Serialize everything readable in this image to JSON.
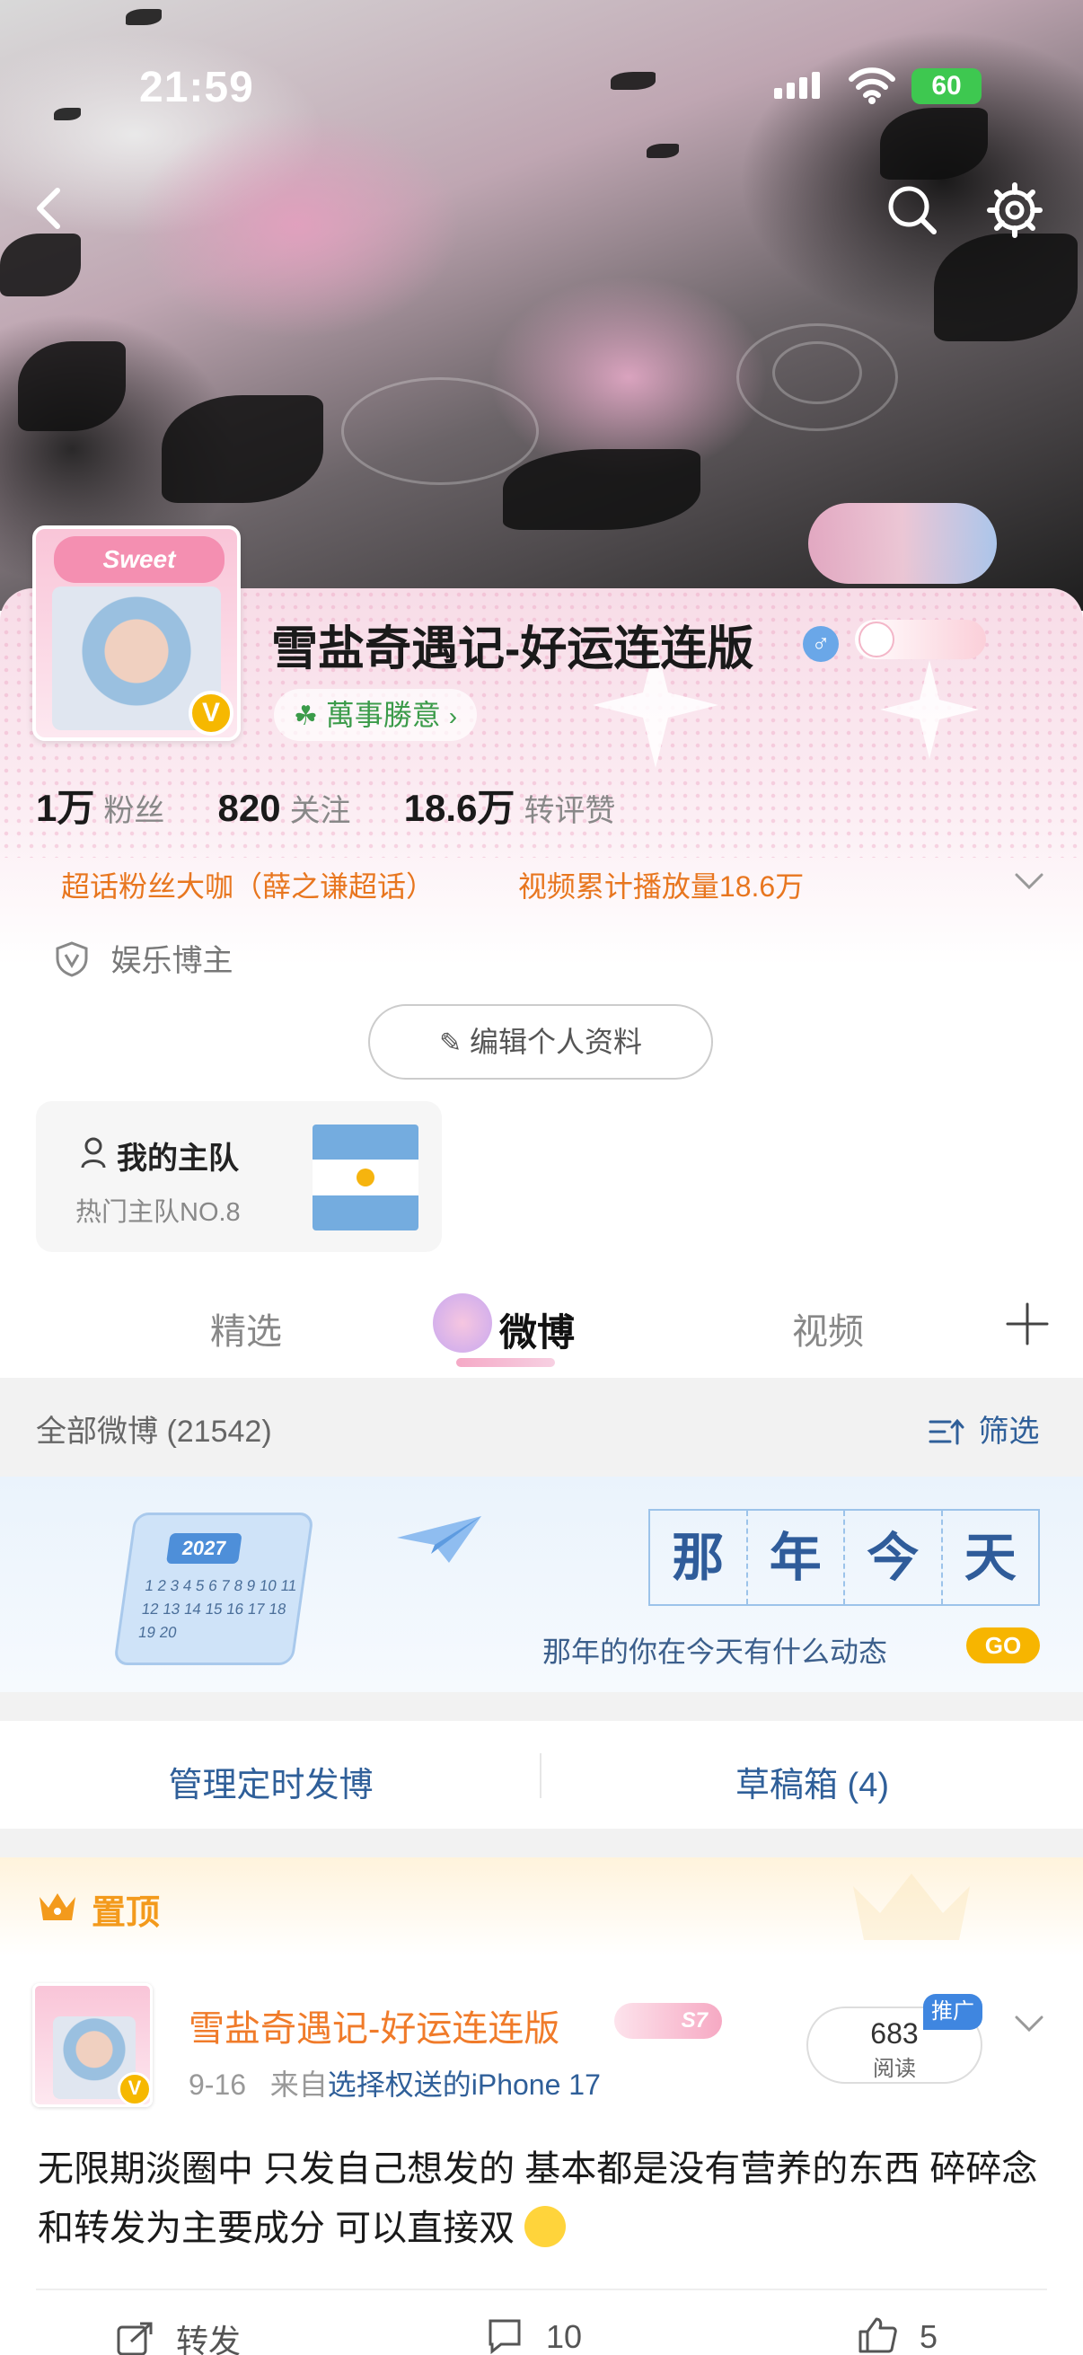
{
  "status_bar": {
    "time": "21:59",
    "battery": "60"
  },
  "profile": {
    "username": "雪盐奇遇记-好运连连版",
    "gender_symbol": "♂",
    "verified_badge": "V",
    "avatar_banner_text": "Sweet",
    "motto": "萬事勝意",
    "stats": [
      {
        "value": "1万",
        "label": "粉丝"
      },
      {
        "value": "820",
        "label": "关注"
      },
      {
        "value": "18.6万",
        "label": "转评赞"
      }
    ],
    "tags": [
      "超话粉丝大咖（薛之谦超话）",
      "视频累计播放量18.6万"
    ],
    "category": "娱乐博主",
    "edit_button": "编辑个人资料",
    "team": {
      "title": "我的主队",
      "subtitle": "热门主队NO.8"
    }
  },
  "tabs": [
    "精选",
    "微博",
    "视频"
  ],
  "active_tab": "微博",
  "feed_header": {
    "all_label": "全部微博 (21542)",
    "filter_label": "筛选"
  },
  "banner": {
    "calendar_year": "2027",
    "calendar_numbers": "1 2 3 4 5 6 7 8 9 10 11 12 13 14 15 16 17 18 19 20",
    "chars": [
      "那",
      "年",
      "今",
      "天"
    ],
    "subtitle": "那年的你在今天有什么动态",
    "go": "GO"
  },
  "manage": {
    "scheduled": "管理定时发博",
    "drafts": "草稿箱 (4)"
  },
  "pinned_label": "置顶",
  "post": {
    "username": "雪盐奇遇记-好运连连版",
    "level": "S7",
    "date": "9-16",
    "from_prefix": "来自",
    "source": "选择权送的iPhone 17",
    "reads_count": "683",
    "reads_label": "阅读",
    "promo": "推广",
    "text": "无限期淡圈中 只发自己想发的 基本都是没有营养的东西 碎碎念和转发为主要成分 可以直接双",
    "actions": {
      "repost": "转发",
      "comment": "10",
      "like": "5"
    }
  },
  "colors": {
    "accent_orange": "#f07b2a",
    "link_blue": "#2f5f99",
    "verified_gold": "#f6b800"
  }
}
